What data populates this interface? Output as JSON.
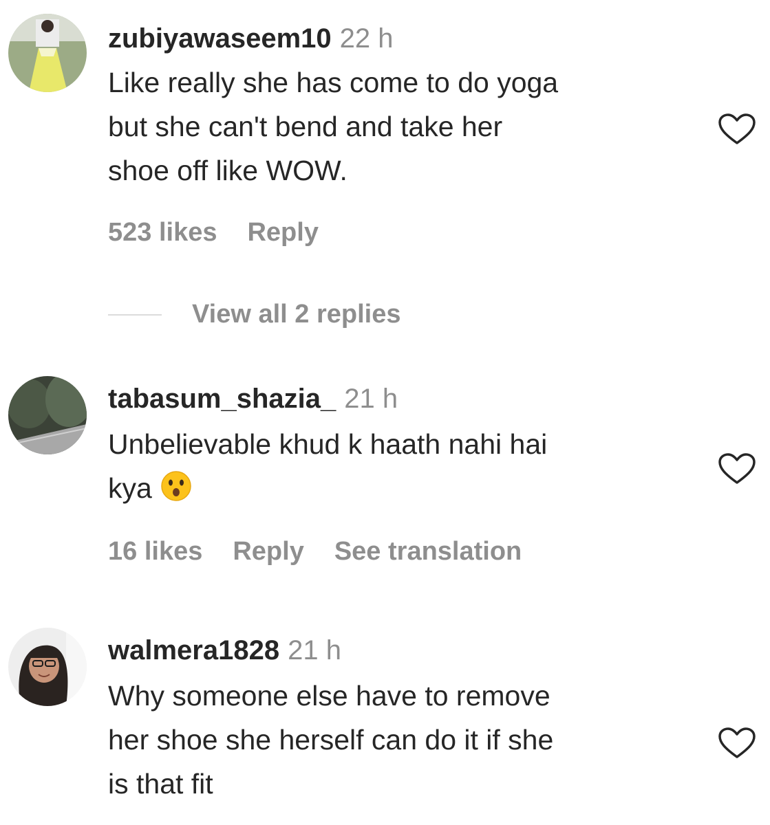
{
  "comments": [
    {
      "username": "zubiyawaseem10",
      "time": "22 h",
      "lines": [
        "Like really she has come to do yoga",
        "but she can't bend and take her",
        "shoe off like WOW."
      ],
      "likes": "523 likes",
      "reply": "Reply",
      "avatar_colors": {
        "bg": "#9cab86",
        "figure": "#e8e86a",
        "top": "#ececec"
      }
    },
    {
      "username": "tabasum_shazia_",
      "time": "21 h",
      "lines": [
        "Unbelievable khud k haath nahi hai",
        "kya"
      ],
      "likes": "16 likes",
      "reply": "Reply",
      "translate": "See translation",
      "emoji_icon": "astonished-face-icon",
      "avatar_colors": {
        "bg": "#3b4237",
        "trees": "#5b6a55",
        "road": "#a8a8a8"
      }
    },
    {
      "username": "walmera1828",
      "time": "21 h",
      "lines": [
        "Why someone else have to remove",
        "her shoe she herself can do it if she",
        "is that fit"
      ],
      "avatar_colors": {
        "bg": "#eeeeee",
        "hair": "#2a2320",
        "skin": "#c9957a"
      }
    }
  ],
  "view_replies": "View all 2 replies",
  "colors": {
    "text": "#262626",
    "secondary": "#8e8e8e",
    "divider": "#dbdbdb"
  }
}
